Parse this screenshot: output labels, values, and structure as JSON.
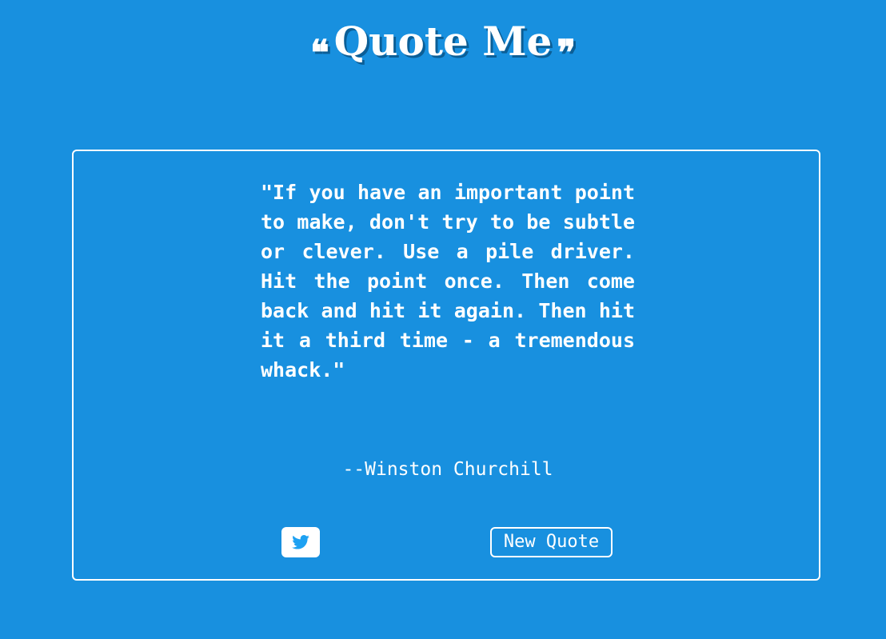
{
  "header": {
    "open_quote": "❝",
    "title": "Quote Me",
    "close_quote": "❞"
  },
  "quote": {
    "text": "\"If you have an important point to make, don't try to be subtle or clever. Use a pile driver. Hit the point once. Then come back and hit it again. Then hit it a third time - a tremendous whack.\"",
    "author": "--Winston Churchill"
  },
  "actions": {
    "tweet_icon": "twitter-icon",
    "new_quote_label": "New Quote"
  },
  "colors": {
    "background": "#1890df",
    "foreground": "#ffffff",
    "twitter_blue": "#1da1f2"
  }
}
